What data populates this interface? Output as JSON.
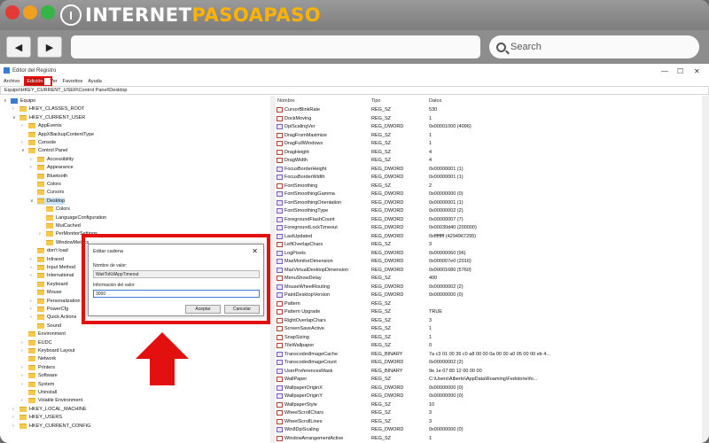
{
  "site": {
    "brand_part1": "INTERNET",
    "brand_part2": "PASOAPASO",
    "logo_letter": "I"
  },
  "browser": {
    "back_icon": "◀",
    "forward_icon": "▶",
    "search_label": "Search"
  },
  "window": {
    "title": "Editor del Registro",
    "address": "Equipo\\HKEY_CURRENT_USER\\Control Panel\\Desktop",
    "menu": [
      "Archivo",
      "Edición",
      "Ver",
      "Favoritos",
      "Ayuda"
    ]
  },
  "tree": [
    {
      "label": "Equipo",
      "indent": 0,
      "arrow": "∨",
      "pc": true
    },
    {
      "label": "HKEY_CLASSES_ROOT",
      "indent": 1,
      "arrow": "›"
    },
    {
      "label": "HKEY_CURRENT_USER",
      "indent": 1,
      "arrow": "∨"
    },
    {
      "label": "AppEvents",
      "indent": 2,
      "arrow": "›"
    },
    {
      "label": "AppXBackupContentType",
      "indent": 2,
      "arrow": ""
    },
    {
      "label": "Console",
      "indent": 2,
      "arrow": "›"
    },
    {
      "label": "Control Panel",
      "indent": 2,
      "arrow": "∨"
    },
    {
      "label": "Accessibility",
      "indent": 3,
      "arrow": "›"
    },
    {
      "label": "Appearance",
      "indent": 3,
      "arrow": "›"
    },
    {
      "label": "Bluetooth",
      "indent": 3,
      "arrow": ""
    },
    {
      "label": "Colors",
      "indent": 3,
      "arrow": ""
    },
    {
      "label": "Cursors",
      "indent": 3,
      "arrow": ""
    },
    {
      "label": "Desktop",
      "indent": 3,
      "arrow": "∨",
      "sel": true
    },
    {
      "label": "Colors",
      "indent": 4,
      "arrow": ""
    },
    {
      "label": "LanguageConfiguration",
      "indent": 4,
      "arrow": ""
    },
    {
      "label": "MuiCached",
      "indent": 4,
      "arrow": ""
    },
    {
      "label": "PerMonitorSettings",
      "indent": 4,
      "arrow": "›"
    },
    {
      "label": "WindowMetrics",
      "indent": 4,
      "arrow": ""
    },
    {
      "label": "don't load",
      "indent": 3,
      "arrow": ""
    },
    {
      "label": "Infrared",
      "indent": 3,
      "arrow": "›"
    },
    {
      "label": "Input Method",
      "indent": 3,
      "arrow": "›"
    },
    {
      "label": "International",
      "indent": 3,
      "arrow": "›"
    },
    {
      "label": "Keyboard",
      "indent": 3,
      "arrow": ""
    },
    {
      "label": "Mouse",
      "indent": 3,
      "arrow": ""
    },
    {
      "label": "Personalization",
      "indent": 3,
      "arrow": "›"
    },
    {
      "label": "PowerCfg",
      "indent": 3,
      "arrow": "›"
    },
    {
      "label": "Quick Actions",
      "indent": 3,
      "arrow": "›"
    },
    {
      "label": "Sound",
      "indent": 3,
      "arrow": ""
    },
    {
      "label": "Environment",
      "indent": 2,
      "arrow": ""
    },
    {
      "label": "EUDC",
      "indent": 2,
      "arrow": "›"
    },
    {
      "label": "Keyboard Layout",
      "indent": 2,
      "arrow": "›"
    },
    {
      "label": "Network",
      "indent": 2,
      "arrow": ""
    },
    {
      "label": "Printers",
      "indent": 2,
      "arrow": "›"
    },
    {
      "label": "Software",
      "indent": 2,
      "arrow": "›"
    },
    {
      "label": "System",
      "indent": 2,
      "arrow": "›"
    },
    {
      "label": "Uninstall",
      "indent": 2,
      "arrow": ""
    },
    {
      "label": "Volatile Environment",
      "indent": 2,
      "arrow": "›"
    },
    {
      "label": "HKEY_LOCAL_MACHINE",
      "indent": 1,
      "arrow": "›"
    },
    {
      "label": "HKEY_USERS",
      "indent": 1,
      "arrow": "›"
    },
    {
      "label": "HKEY_CURRENT_CONFIG",
      "indent": 1,
      "arrow": "›"
    }
  ],
  "list": {
    "headers": [
      "Nombre",
      "Tipo",
      "Datos"
    ],
    "rows": [
      [
        "CursorBlinkRate",
        "REG_SZ",
        "530"
      ],
      [
        "DockMoving",
        "REG_SZ",
        "1"
      ],
      [
        "DpiScalingVer",
        "REG_DWORD",
        "0x00001000 (4096)"
      ],
      [
        "DragFromMaximize",
        "REG_SZ",
        "1"
      ],
      [
        "DragFullWindows",
        "REG_SZ",
        "1"
      ],
      [
        "DragHeight",
        "REG_SZ",
        "4"
      ],
      [
        "DragWidth",
        "REG_SZ",
        "4"
      ],
      [
        "FocusBorderHeight",
        "REG_DWORD",
        "0x00000001 (1)"
      ],
      [
        "FocusBorderWidth",
        "REG_DWORD",
        "0x00000001 (1)"
      ],
      [
        "FontSmoothing",
        "REG_SZ",
        "2"
      ],
      [
        "FontSmoothingGamma",
        "REG_DWORD",
        "0x00000000 (0)"
      ],
      [
        "FontSmoothingOrientation",
        "REG_DWORD",
        "0x00000001 (1)"
      ],
      [
        "FontSmoothingType",
        "REG_DWORD",
        "0x00000002 (2)"
      ],
      [
        "ForegroundFlashCount",
        "REG_DWORD",
        "0x00000007 (7)"
      ],
      [
        "ForegroundLockTimeout",
        "REG_DWORD",
        "0x00030d40 (200000)"
      ],
      [
        "LastUpdated",
        "REG_DWORD",
        "0xffffffff (4294967295)"
      ],
      [
        "LeftOverlapChars",
        "REG_SZ",
        "3"
      ],
      [
        "LogPixels",
        "REG_DWORD",
        "0x00000060 (96)"
      ],
      [
        "MaxMonitorDimension",
        "REG_DWORD",
        "0x000007e0 (2016)"
      ],
      [
        "MaxVirtualDesktopDimension",
        "REG_DWORD",
        "0x00001680 (5760)"
      ],
      [
        "MenuShowDelay",
        "REG_SZ",
        "400"
      ],
      [
        "MouseWheelRouting",
        "REG_DWORD",
        "0x00000002 (2)"
      ],
      [
        "PaintDesktopVersion",
        "REG_DWORD",
        "0x00000000 (0)"
      ],
      [
        "Pattern",
        "REG_SZ",
        ""
      ],
      [
        "Pattern Upgrade",
        "REG_SZ",
        "TRUE"
      ],
      [
        "RightOverlapChars",
        "REG_SZ",
        "3"
      ],
      [
        "ScreenSaveActive",
        "REG_SZ",
        "1"
      ],
      [
        "SnapSizing",
        "REG_SZ",
        "1"
      ],
      [
        "TileWallpaper",
        "REG_SZ",
        "0"
      ],
      [
        "TranscodedImageCache",
        "REG_BINARY",
        "7a c3 01 00 36 c0 a8 00 00 0a 00 00 a0 05 00 00 eb 4..."
      ],
      [
        "TranscodedImageCount",
        "REG_DWORD",
        "0x00000002 (2)"
      ],
      [
        "UserPreferencesMask",
        "REG_BINARY",
        "9e 1e 07 80 12 00 00 00"
      ],
      [
        "WallPaper",
        "REG_SZ",
        "C:\\Users\\Alberto\\AppData\\Roaming\\Fedotone\\fo..."
      ],
      [
        "WallpaperOriginX",
        "REG_DWORD",
        "0x00000000 (0)"
      ],
      [
        "WallpaperOriginY",
        "REG_DWORD",
        "0x00000000 (0)"
      ],
      [
        "WallpaperStyle",
        "REG_SZ",
        "10"
      ],
      [
        "WheelScrollChars",
        "REG_SZ",
        "3"
      ],
      [
        "WheelScrollLines",
        "REG_SZ",
        "3"
      ],
      [
        "Win8DpiScaling",
        "REG_DWORD",
        "0x00000000 (0)"
      ],
      [
        "WindowArrangementActive",
        "REG_SZ",
        "1"
      ]
    ]
  },
  "dialog": {
    "title": "Editar cadena",
    "close": "✕",
    "name_label": "Nombre de valor:",
    "name_value": "WaitToKillAppTimeout",
    "data_label": "Información del valor:",
    "data_value": "3000",
    "ok": "Aceptar",
    "cancel": "Cancelar"
  },
  "colors": {
    "highlight": "#e31010",
    "close_light": "#e53935",
    "min_light": "#f0a020",
    "max_light": "#35b545"
  }
}
